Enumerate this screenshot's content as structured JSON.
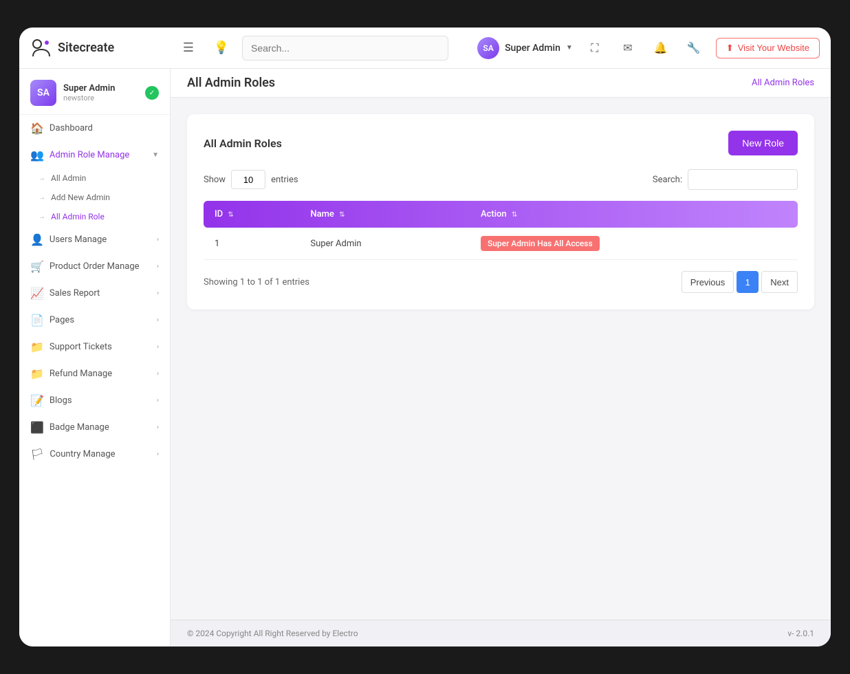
{
  "app": {
    "logo_text": "Sitecreate",
    "visit_website_label": "Visit Your Website"
  },
  "navbar": {
    "search_placeholder": "Search...",
    "user_name": "Super Admin",
    "user_initials": "SA"
  },
  "sidebar": {
    "user": {
      "name": "Super Admin",
      "store": "newstore",
      "initials": "SA"
    },
    "nav_items": [
      {
        "label": "Dashboard",
        "icon": "🏠",
        "active": false
      },
      {
        "label": "Admin Role Manage",
        "icon": "👥",
        "active": true,
        "expanded": true
      },
      {
        "label": "Users Manage",
        "icon": "👤",
        "active": false
      },
      {
        "label": "Product Order Manage",
        "icon": "🛒",
        "active": false
      },
      {
        "label": "Sales Report",
        "icon": "📈",
        "active": false
      },
      {
        "label": "Pages",
        "icon": "📄",
        "active": false
      },
      {
        "label": "Support Tickets",
        "icon": "📁",
        "active": false
      },
      {
        "label": "Refund Manage",
        "icon": "📁",
        "active": false
      },
      {
        "label": "Blogs",
        "icon": "📝",
        "active": false
      },
      {
        "label": "Badge Manage",
        "icon": "⬛",
        "active": false
      },
      {
        "label": "Country Manage",
        "icon": "🏳",
        "active": false
      }
    ],
    "sub_items": [
      {
        "label": "All Admin",
        "active": false
      },
      {
        "label": "Add New Admin",
        "active": false
      },
      {
        "label": "All Admin Role",
        "active": true
      }
    ]
  },
  "breadcrumb": {
    "page_title": "All Admin Roles",
    "breadcrumb_label": "All Admin Roles"
  },
  "card": {
    "title": "All Admin Roles",
    "new_role_label": "New Role"
  },
  "table_controls": {
    "show_label": "Show",
    "entries_label": "entries",
    "entries_value": "10",
    "search_label": "Search:"
  },
  "table": {
    "headers": [
      {
        "label": "ID",
        "sortable": true
      },
      {
        "label": "Name",
        "sortable": true
      },
      {
        "label": "Action",
        "sortable": true
      }
    ],
    "rows": [
      {
        "id": "1",
        "name": "Super Admin",
        "action_label": "Super Admin Has All Access",
        "action_color": "#f87171"
      }
    ]
  },
  "pagination": {
    "showing_text": "Showing 1 to 1 of 1 entries",
    "previous_label": "Previous",
    "next_label": "Next",
    "current_page": "1"
  },
  "footer": {
    "copyright": "© 2024 Copyright All Right Reserved by Electro",
    "version": "v- 2.0.1"
  }
}
